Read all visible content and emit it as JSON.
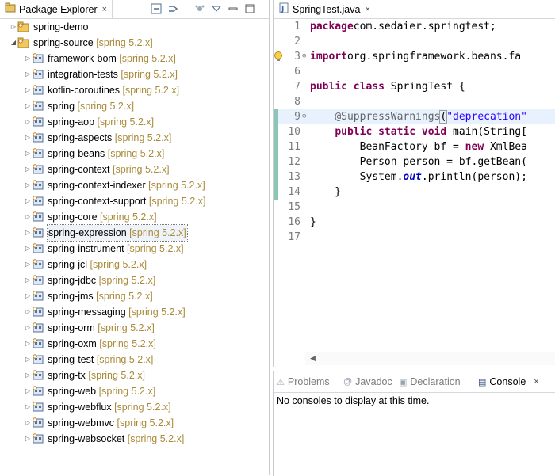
{
  "explorer": {
    "tab_label": "Package Explorer",
    "close": "×",
    "toolbar": {
      "collapse_icon": "collapse-all-icon",
      "link_icon": "link-with-editor-icon",
      "focus_icon": "focus-icon",
      "menu_icon": "view-menu-icon",
      "minimize_icon": "minimize-icon",
      "maximize_icon": "maximize-icon"
    },
    "tree": [
      {
        "label": "spring-demo",
        "version": "",
        "level": 0,
        "twisty": "▷",
        "icon": "project-icon",
        "kind": "demo"
      },
      {
        "label": "spring-source",
        "version": "[spring 5.2.x]",
        "level": 0,
        "twisty": "◢",
        "icon": "project-icon",
        "kind": "source"
      },
      {
        "label": "framework-bom",
        "version": "[spring 5.2.x]",
        "level": 1,
        "twisty": "▷",
        "icon": "gradle-project-icon"
      },
      {
        "label": "integration-tests",
        "version": "[spring 5.2.x]",
        "level": 1,
        "twisty": "▷",
        "icon": "gradle-project-icon"
      },
      {
        "label": "kotlin-coroutines",
        "version": "[spring 5.2.x]",
        "level": 1,
        "twisty": "▷",
        "icon": "gradle-project-icon"
      },
      {
        "label": "spring",
        "version": "[spring 5.2.x]",
        "level": 1,
        "twisty": "▷",
        "icon": "gradle-project-icon"
      },
      {
        "label": "spring-aop",
        "version": "[spring 5.2.x]",
        "level": 1,
        "twisty": "▷",
        "icon": "gradle-project-icon"
      },
      {
        "label": "spring-aspects",
        "version": "[spring 5.2.x]",
        "level": 1,
        "twisty": "▷",
        "icon": "gradle-project-icon"
      },
      {
        "label": "spring-beans",
        "version": "[spring 5.2.x]",
        "level": 1,
        "twisty": "▷",
        "icon": "gradle-project-icon"
      },
      {
        "label": "spring-context",
        "version": "[spring 5.2.x]",
        "level": 1,
        "twisty": "▷",
        "icon": "gradle-project-icon"
      },
      {
        "label": "spring-context-indexer",
        "version": "[spring 5.2.x]",
        "level": 1,
        "twisty": "▷",
        "icon": "gradle-project-icon"
      },
      {
        "label": "spring-context-support",
        "version": "[spring 5.2.x]",
        "level": 1,
        "twisty": "▷",
        "icon": "gradle-project-icon"
      },
      {
        "label": "spring-core",
        "version": "[spring 5.2.x]",
        "level": 1,
        "twisty": "▷",
        "icon": "gradle-project-icon"
      },
      {
        "label": "spring-expression",
        "version": "[spring 5.2.x]",
        "level": 1,
        "twisty": "▷",
        "icon": "gradle-project-icon",
        "selected": true
      },
      {
        "label": "spring-instrument",
        "version": "[spring 5.2.x]",
        "level": 1,
        "twisty": "▷",
        "icon": "gradle-project-icon"
      },
      {
        "label": "spring-jcl",
        "version": "[spring 5.2.x]",
        "level": 1,
        "twisty": "▷",
        "icon": "gradle-project-icon"
      },
      {
        "label": "spring-jdbc",
        "version": "[spring 5.2.x]",
        "level": 1,
        "twisty": "▷",
        "icon": "gradle-project-icon"
      },
      {
        "label": "spring-jms",
        "version": "[spring 5.2.x]",
        "level": 1,
        "twisty": "▷",
        "icon": "gradle-project-icon"
      },
      {
        "label": "spring-messaging",
        "version": "[spring 5.2.x]",
        "level": 1,
        "twisty": "▷",
        "icon": "gradle-project-icon"
      },
      {
        "label": "spring-orm",
        "version": "[spring 5.2.x]",
        "level": 1,
        "twisty": "▷",
        "icon": "gradle-project-icon"
      },
      {
        "label": "spring-oxm",
        "version": "[spring 5.2.x]",
        "level": 1,
        "twisty": "▷",
        "icon": "gradle-project-icon"
      },
      {
        "label": "spring-test",
        "version": "[spring 5.2.x]",
        "level": 1,
        "twisty": "▷",
        "icon": "gradle-project-icon"
      },
      {
        "label": "spring-tx",
        "version": "[spring 5.2.x]",
        "level": 1,
        "twisty": "▷",
        "icon": "gradle-project-icon"
      },
      {
        "label": "spring-web",
        "version": "[spring 5.2.x]",
        "level": 1,
        "twisty": "▷",
        "icon": "gradle-project-icon"
      },
      {
        "label": "spring-webflux",
        "version": "[spring 5.2.x]",
        "level": 1,
        "twisty": "▷",
        "icon": "gradle-project-icon"
      },
      {
        "label": "spring-webmvc",
        "version": "[spring 5.2.x]",
        "level": 1,
        "twisty": "▷",
        "icon": "gradle-project-icon"
      },
      {
        "label": "spring-websocket",
        "version": "[spring 5.2.x]",
        "level": 1,
        "twisty": "▷",
        "icon": "gradle-project-icon"
      }
    ]
  },
  "editor": {
    "tab_label": "SpringTest.java",
    "close": "×",
    "lines": [
      {
        "n": "1",
        "segs": [
          [
            "kw",
            "package"
          ],
          [
            "",
            "com.sedaier.springtest;"
          ]
        ]
      },
      {
        "n": "2",
        "segs": []
      },
      {
        "n": "3",
        "fold": "⊕",
        "warn": true,
        "segs": [
          [
            "kw",
            "import"
          ],
          [
            "",
            "org.springframework.beans.fa"
          ]
        ]
      },
      {
        "n": "6",
        "segs": []
      },
      {
        "n": "7",
        "segs": [
          [
            "kw",
            "public"
          ],
          [
            "kw",
            " class"
          ],
          [
            "",
            " SpringTest {"
          ]
        ]
      },
      {
        "n": "8",
        "segs": []
      },
      {
        "n": "9",
        "fold": "⊖",
        "current": true,
        "changed": true,
        "segs": [
          [
            "",
            "    "
          ],
          [
            "ann",
            "@SuppressWarnings"
          ],
          [
            "paren",
            "("
          ],
          [
            "str",
            "\"deprecation\""
          ]
        ]
      },
      {
        "n": "10",
        "changed": true,
        "segs": [
          [
            "",
            "    "
          ],
          [
            "kw",
            "public"
          ],
          [
            "kw",
            " static"
          ],
          [
            "kw",
            " void"
          ],
          [
            "",
            " main(String["
          ]
        ]
      },
      {
        "n": "11",
        "changed": true,
        "segs": [
          [
            "",
            "        BeanFactory bf = "
          ],
          [
            "kw",
            "new"
          ],
          [
            "",
            " "
          ],
          [
            "strike",
            "XmlBea"
          ]
        ]
      },
      {
        "n": "12",
        "changed": true,
        "segs": [
          [
            "",
            "        Person person = bf.getBean("
          ]
        ]
      },
      {
        "n": "13",
        "changed": true,
        "segs": [
          [
            "",
            "        System."
          ],
          [
            "field",
            "out"
          ],
          [
            "",
            ".println(person);"
          ]
        ]
      },
      {
        "n": "14",
        "changed": true,
        "segs": [
          [
            "",
            "    }"
          ]
        ]
      },
      {
        "n": "15",
        "segs": []
      },
      {
        "n": "16",
        "segs": [
          [
            "",
            "}"
          ]
        ]
      },
      {
        "n": "17",
        "segs": []
      }
    ]
  },
  "bottom": {
    "tabs": [
      {
        "label": "Problems",
        "icon": "problems-icon",
        "glyph": "⚠",
        "active": false
      },
      {
        "label": "Javadoc",
        "icon": "javadoc-icon",
        "glyph": "@",
        "active": false
      },
      {
        "label": "Declaration",
        "icon": "declaration-icon",
        "glyph": "▣",
        "active": false
      },
      {
        "label": "Console",
        "icon": "console-icon",
        "glyph": "▤",
        "active": true
      }
    ],
    "console_close": "×",
    "console_message": "No consoles to display at this time."
  },
  "colors": {
    "keyword": "#7f0055",
    "string": "#2a00ff",
    "annotation": "#646464",
    "version": "#a98a3a",
    "change_bar": "#8ac6b3"
  }
}
